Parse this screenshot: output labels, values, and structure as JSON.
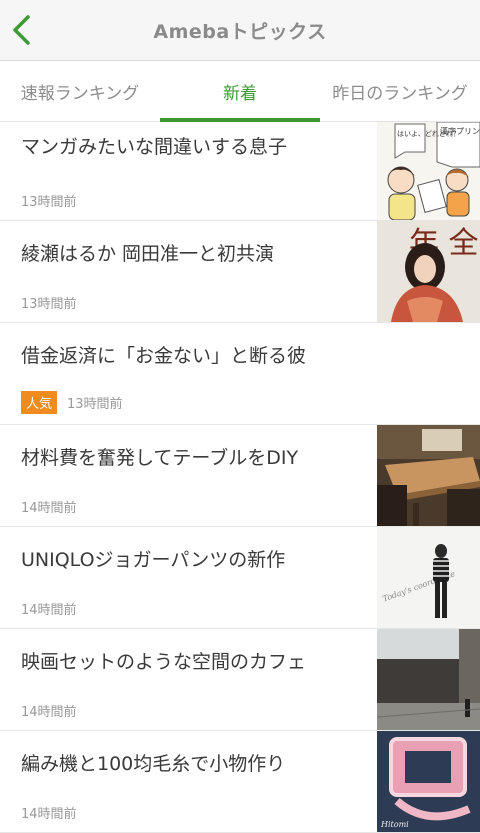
{
  "header": {
    "title": "Amebaトピックス"
  },
  "tabs": [
    {
      "label": "速報ランキング"
    },
    {
      "label": "新着"
    },
    {
      "label": "昨日のランキング"
    }
  ],
  "items": [
    {
      "title": "マンガみたいな間違いする息子",
      "time": "13時間前",
      "badge": "",
      "thumb": "manga"
    },
    {
      "title": "綾瀬はるか 岡田准一と初共演",
      "time": "13時間前",
      "badge": "",
      "thumb": "actress"
    },
    {
      "title": "借金返済に「お金ない」と断る彼",
      "time": "13時間前",
      "badge": "人気",
      "thumb": ""
    },
    {
      "title": "材料費を奮発してテーブルをDIY",
      "time": "14時間前",
      "badge": "",
      "thumb": "table"
    },
    {
      "title": "UNIQLOジョガーパンツの新作",
      "time": "14時間前",
      "badge": "",
      "thumb": "fashion"
    },
    {
      "title": "映画セットのような空間のカフェ",
      "time": "14時間前",
      "badge": "",
      "thumb": "cafe"
    },
    {
      "title": "編み機と100均毛糸で小物作り",
      "time": "14時間前",
      "badge": "",
      "thumb": "knit"
    }
  ],
  "thumb_text": {
    "manga_bubble1": "漢字プリント間違いないか見て〜",
    "manga_bubble2": "はいよ、どれどれ？",
    "actress_text": "年 全",
    "fashion_text": "Today's coordinate",
    "knit_text": "Hitomi"
  },
  "colors": {
    "accent": "#3d9a35",
    "badge": "#f08c1e"
  }
}
